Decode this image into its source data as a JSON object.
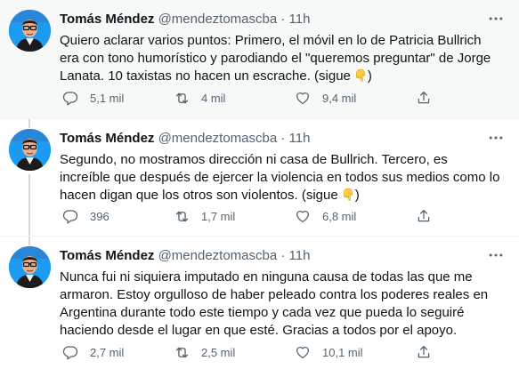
{
  "colors": {
    "text": "#0f1419",
    "secondary": "#536471",
    "thread_line": "#cfd9de",
    "divider": "#eff3f4",
    "highlight_bg": "#f7f9f9",
    "avatar_bg": "#1d9bf0"
  },
  "tweets": [
    {
      "author_name": "Tomás Méndez",
      "handle": "@mendeztomascba",
      "separator": "·",
      "time": "11h",
      "text": "Quiero aclarar varios puntos: Primero, el móvil en lo de Patricia Bullrich era con tono humorístico y parodiando el \"queremos preguntar\" de Jorge Lanata. 10 taxistas no hacen un escrache. (sigue",
      "emoji": "pointing-down-hand",
      "text_after_emoji": ")",
      "replies": "5,1 mil",
      "retweets": "4 mil",
      "likes": "9,4 mil"
    },
    {
      "author_name": "Tomás Méndez",
      "handle": "@mendeztomascba",
      "separator": "·",
      "time": "11h",
      "text": "Segundo, no mostramos dirección ni casa de Bullrich. Tercero, es increíble que después de ejercer la violencia en todos sus medios como lo hacen digan que los otros son violentos. (sigue",
      "emoji": "pointing-down-hand",
      "text_after_emoji": ")",
      "replies": "396",
      "retweets": "1,7 mil",
      "likes": "6,8 mil"
    },
    {
      "author_name": "Tomás Méndez",
      "handle": "@mendeztomascba",
      "separator": "·",
      "time": "11h",
      "text": "Nunca fui ni siquiera imputado en ninguna causa de todas las que me armaron. Estoy orgulloso de haber peleado contra los poderes reales en Argentina durante todo este tiempo y cada vez que pueda lo seguiré haciendo desde el lugar en que esté. Gracias a todos por el apoyo.",
      "replies": "2,7 mil",
      "retweets": "2,5 mil",
      "likes": "10,1 mil"
    }
  ]
}
